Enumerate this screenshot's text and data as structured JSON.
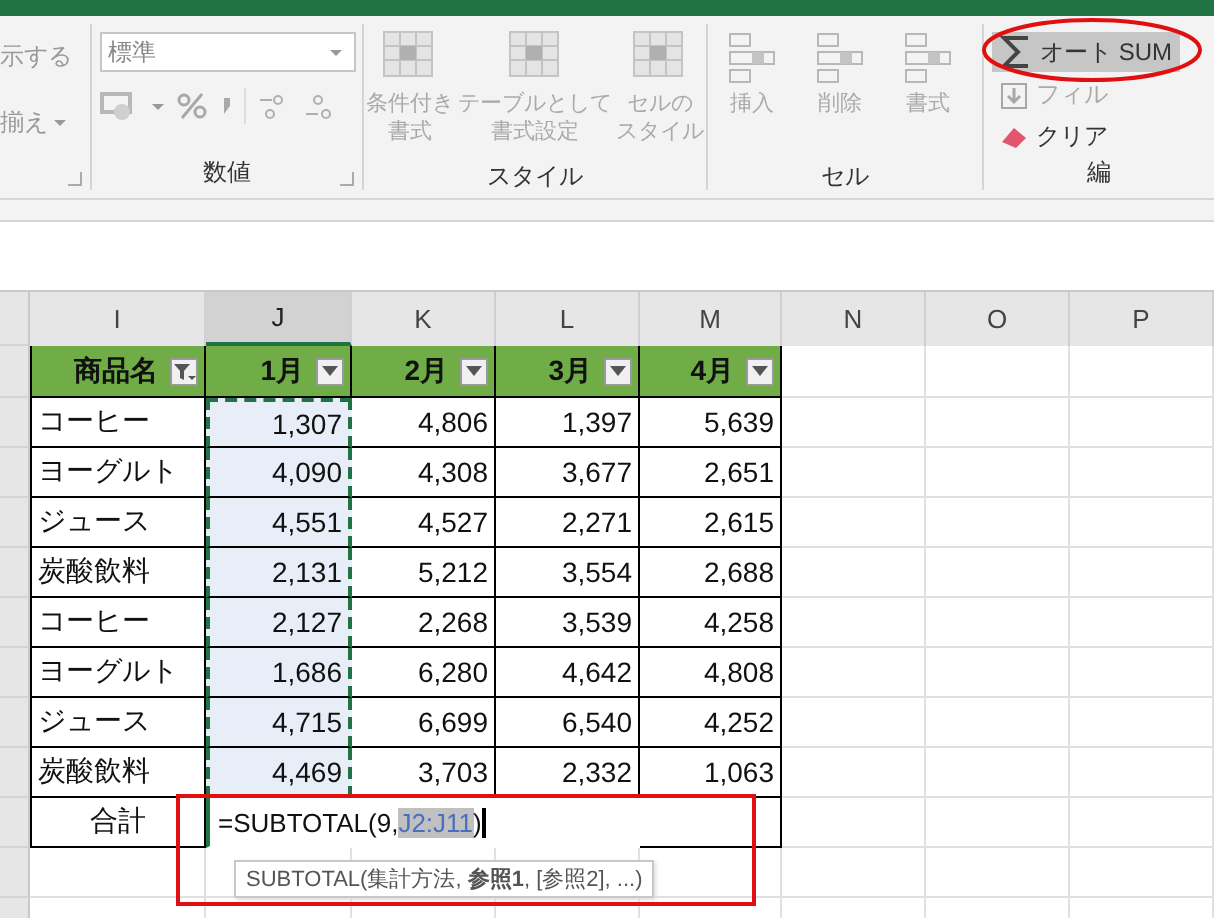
{
  "alignment_group": {
    "items": [
      {
        "label": "示する",
        "caret": false
      },
      {
        "label": "揃え",
        "caret": true
      }
    ]
  },
  "number_group": {
    "label": "数値",
    "format_select": {
      "value": "標準"
    }
  },
  "style_group": {
    "label": "スタイル",
    "buttons": [
      {
        "lines": [
          "条件付き",
          "書式"
        ],
        "disabled": true
      },
      {
        "lines": [
          "テーブルとして",
          "書式設定"
        ],
        "disabled": true
      },
      {
        "lines": [
          "セルの",
          "スタイル"
        ],
        "disabled": true
      }
    ]
  },
  "cells_group": {
    "label": "セル",
    "buttons": [
      {
        "lines": [
          "挿入"
        ],
        "disabled": true
      },
      {
        "lines": [
          "削除"
        ],
        "disabled": true
      },
      {
        "lines": [
          "書式"
        ],
        "disabled": true
      }
    ]
  },
  "editing_group": {
    "label": "編",
    "autosum": {
      "label": "オート SUM",
      "highlighted": true
    },
    "fill": {
      "label": "フィル",
      "disabled": true
    },
    "clear": {
      "label": "クリア",
      "disabled": false
    }
  },
  "columns": [
    {
      "letter": "I",
      "selected": false
    },
    {
      "letter": "J",
      "selected": true
    },
    {
      "letter": "K",
      "selected": false
    },
    {
      "letter": "L",
      "selected": false
    },
    {
      "letter": "M",
      "selected": false
    },
    {
      "letter": "N",
      "selected": false
    },
    {
      "letter": "O",
      "selected": false
    },
    {
      "letter": "P",
      "selected": false
    }
  ],
  "table": {
    "headers": [
      {
        "label": "商品名",
        "filtered": true
      },
      {
        "label": "1月",
        "filtered": false
      },
      {
        "label": "2月",
        "filtered": false
      },
      {
        "label": "3月",
        "filtered": false
      },
      {
        "label": "4月",
        "filtered": false
      }
    ],
    "rows": [
      {
        "name": "コーヒー",
        "values": [
          "1,307",
          "4,806",
          "1,397",
          "5,639"
        ]
      },
      {
        "name": "ヨーグルト",
        "values": [
          "4,090",
          "4,308",
          "3,677",
          "2,651"
        ]
      },
      {
        "name": "ジュース",
        "values": [
          "4,551",
          "4,527",
          "2,271",
          "2,615"
        ]
      },
      {
        "name": "炭酸飲料",
        "values": [
          "2,131",
          "5,212",
          "3,554",
          "2,688"
        ]
      },
      {
        "name": "コーヒー",
        "values": [
          "2,127",
          "2,268",
          "3,539",
          "4,258"
        ]
      },
      {
        "name": "ヨーグルト",
        "values": [
          "1,686",
          "6,280",
          "4,642",
          "4,808"
        ]
      },
      {
        "name": "ジュース",
        "values": [
          "4,715",
          "6,699",
          "6,540",
          "4,252"
        ]
      },
      {
        "name": "炭酸飲料",
        "values": [
          "4,469",
          "3,703",
          "2,332",
          "1,063"
        ]
      }
    ],
    "total": {
      "label": "合計",
      "formula_start": "=SUBTOTAL(9,",
      "formula_reference": "J2:J11",
      "formula_end": ")"
    },
    "formula_tip": "SUBTOTAL(集計方法, **参照1**, [参照2], ...)"
  }
}
